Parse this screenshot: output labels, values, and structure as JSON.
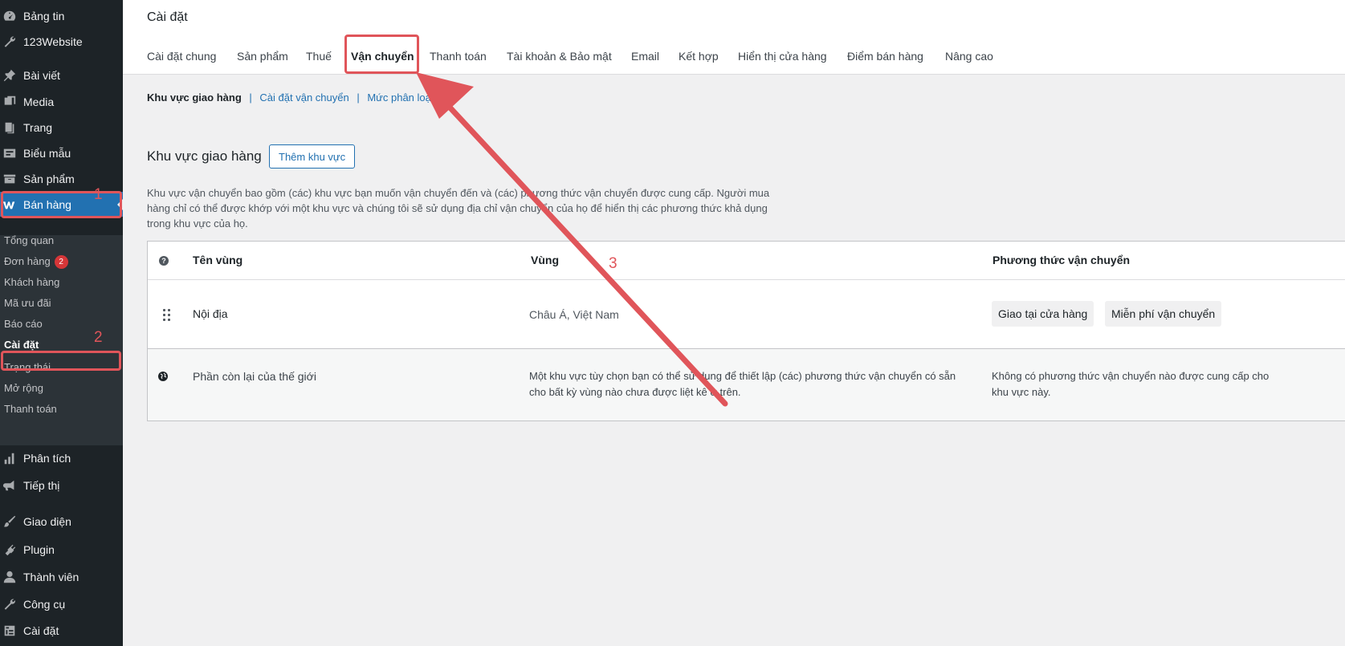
{
  "sidebar": {
    "items": [
      {
        "label": "Bảng tin",
        "icon": "dashboard-icon"
      },
      {
        "label": "123Website",
        "icon": "wrench-icon"
      },
      {
        "label": "Bài viết",
        "icon": "pin-icon"
      },
      {
        "label": "Media",
        "icon": "media-icon"
      },
      {
        "label": "Trang",
        "icon": "page-icon"
      },
      {
        "label": "Biểu mẫu",
        "icon": "form-icon"
      },
      {
        "label": "Sản phẩm",
        "icon": "archive-icon"
      },
      {
        "label": "Bán hàng",
        "icon": "woo-icon"
      },
      {
        "label": "Phân tích",
        "icon": "chart-icon"
      },
      {
        "label": "Tiếp thị",
        "icon": "megaphone-icon"
      },
      {
        "label": "Giao diện",
        "icon": "brush-icon"
      },
      {
        "label": "Plugin",
        "icon": "plugin-icon"
      },
      {
        "label": "Thành viên",
        "icon": "user-icon"
      },
      {
        "label": "Công cụ",
        "icon": "tools-icon"
      },
      {
        "label": "Cài đặt",
        "icon": "settings-icon"
      }
    ],
    "submenu": [
      {
        "label": "Tổng quan"
      },
      {
        "label": "Đơn hàng",
        "badge": "2"
      },
      {
        "label": "Khách hàng"
      },
      {
        "label": "Mã ưu đãi"
      },
      {
        "label": "Báo cáo"
      },
      {
        "label": "Cài đặt"
      },
      {
        "label": "Trạng thái"
      },
      {
        "label": "Mở rộng"
      },
      {
        "label": "Thanh toán"
      }
    ],
    "active_color": "#2271b1"
  },
  "header": {
    "title": "Cài đặt",
    "tabs": [
      {
        "label": "Cài đặt chung"
      },
      {
        "label": "Sản phẩm"
      },
      {
        "label": "Thuế"
      },
      {
        "label": "Vận chuyển"
      },
      {
        "label": "Thanh toán"
      },
      {
        "label": "Tài khoản & Bảo mật"
      },
      {
        "label": "Email"
      },
      {
        "label": "Kết hợp"
      },
      {
        "label": "Hiển thị cửa hàng"
      },
      {
        "label": "Điểm bán hàng"
      },
      {
        "label": "Nâng cao"
      }
    ]
  },
  "subnav": {
    "items": [
      "Khu vực giao hàng",
      "Cài đặt vận chuyển",
      "Mức phân loại"
    ],
    "separator": "|"
  },
  "zones": {
    "heading": "Khu vực giao hàng",
    "add_button": "Thêm khu vực",
    "description": "Khu vực vận chuyển bao gồm (các) khu vực bạn muốn vận chuyển đến và (các) phương thức vận chuyển được cung cấp. Người mua hàng chỉ có thể được khớp với một khu vực và chúng tôi sẽ sử dụng địa chỉ vận chuyển của họ để hiển thị các phương thức khả dụng trong khu vực của họ.",
    "columns": {
      "help": "?",
      "name": "Tên vùng",
      "region": "Vùng",
      "methods": "Phương thức vận chuyển"
    },
    "rows": [
      {
        "name": "Nội địa",
        "region": "Châu Á, Việt Nam",
        "methods": [
          "Giao tại cửa hàng",
          "Miễn phí vận chuyển"
        ]
      },
      {
        "name": "Phần còn lại của thế giới",
        "region": "Một khu vực tùy chọn bạn có thể sử dụng để thiết lập (các) phương thức vận chuyển có sẵn cho bất kỳ vùng nào chưa được liệt kê ở trên.",
        "methods_text": "Không có phương thức vận chuyển nào được cung cấp cho khu vực này."
      }
    ]
  },
  "annotations": {
    "labels": [
      "1",
      "2",
      "3"
    ],
    "color": "#e0555a"
  }
}
